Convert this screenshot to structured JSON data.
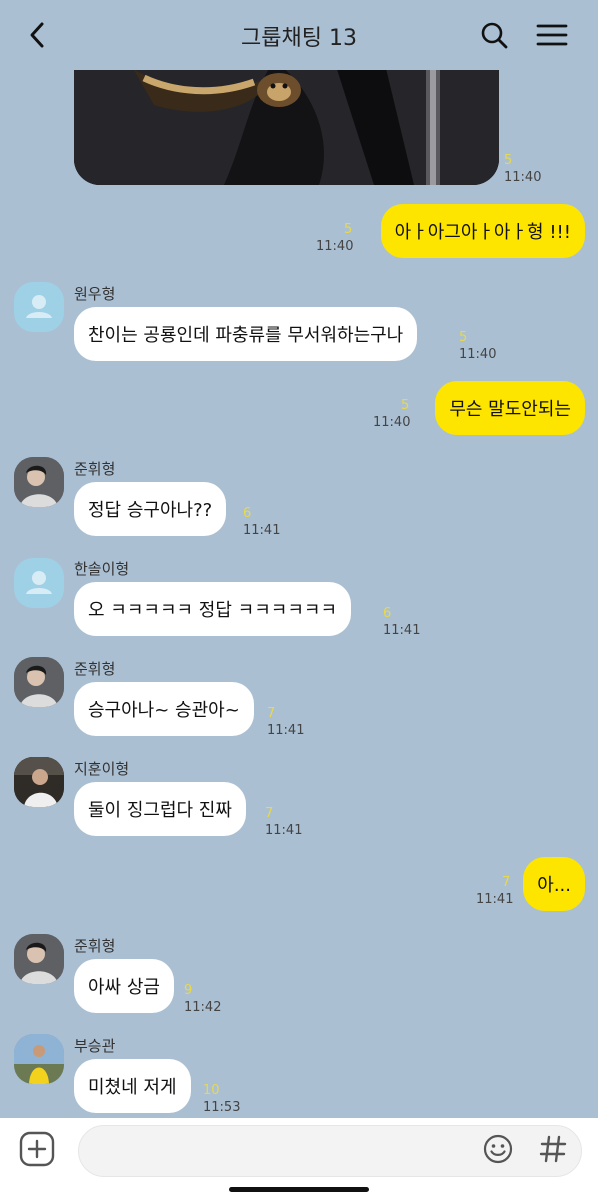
{
  "header": {
    "title": "그룹채팅 13"
  },
  "top_image": {
    "unread": "5",
    "time": "11:40"
  },
  "messages": [
    {
      "text": "아ㅏ아그아ㅏ아ㅏ형 !!!",
      "unread": "5",
      "time": "11:40"
    },
    {
      "sender": "원우형",
      "text": "찬이는 공룡인데 파충류를 무서워하는구나",
      "unread": "5",
      "time": "11:40"
    },
    {
      "text": "무슨 말도안되는",
      "unread": "5",
      "time": "11:40"
    },
    {
      "sender": "준휘형",
      "text": "정답 승구아나??",
      "unread": "6",
      "time": "11:41"
    },
    {
      "sender": "한솔이형",
      "text": "오 ㅋㅋㅋㅋㅋ 정답 ㅋㅋㅋㅋㅋㅋ",
      "unread": "6",
      "time": "11:41"
    },
    {
      "sender": "준휘형",
      "text": "승구아나~ 승관아~",
      "unread": "7",
      "time": "11:41"
    },
    {
      "sender": "지훈이형",
      "text": "둘이 징그럽다 진짜",
      "unread": "7",
      "time": "11:41"
    },
    {
      "text": "아...",
      "unread": "7",
      "time": "11:41"
    },
    {
      "sender": "준휘형",
      "text": "아싸 상금",
      "unread": "9",
      "time": "11:42"
    },
    {
      "sender": "부승관",
      "text": "미쳤네 저게",
      "unread": "10",
      "time": "11:53"
    }
  ],
  "icons": {
    "back": "back-arrow-icon",
    "search": "search-icon",
    "menu": "menu-icon",
    "plus": "plus-icon",
    "emoji": "emoji-icon",
    "hash": "hash-icon"
  },
  "colors": {
    "background": "#abbfd3",
    "my_bubble": "#fee500",
    "their_bubble": "#ffffff",
    "unread": "#e8d94a"
  }
}
